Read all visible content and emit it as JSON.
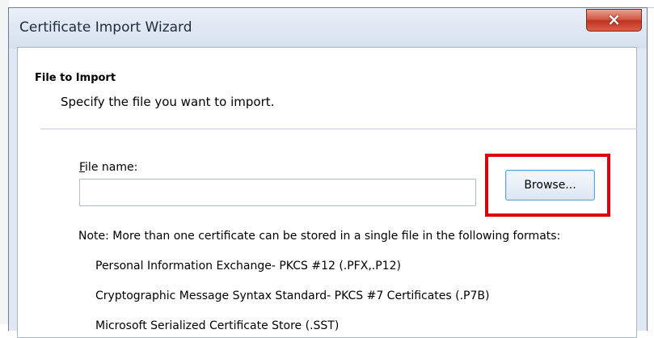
{
  "window": {
    "title": "Certificate Import Wizard",
    "close_symbol": "×"
  },
  "page": {
    "heading": "File to Import",
    "subheading": "Specify the file you want to import."
  },
  "file": {
    "label_mnemonic": "F",
    "label_rest": "ile name:",
    "value": "",
    "browse_label": "Browse..."
  },
  "highlight": {
    "color": "#e0000d"
  },
  "note": "Note:  More than one certificate can be stored in a single file in the following formats:",
  "formats": [
    "Personal Information Exchange- PKCS #12 (.PFX,.P12)",
    "Cryptographic Message Syntax Standard- PKCS #7 Certificates (.P7B)",
    "Microsoft Serialized Certificate Store (.SST)"
  ]
}
